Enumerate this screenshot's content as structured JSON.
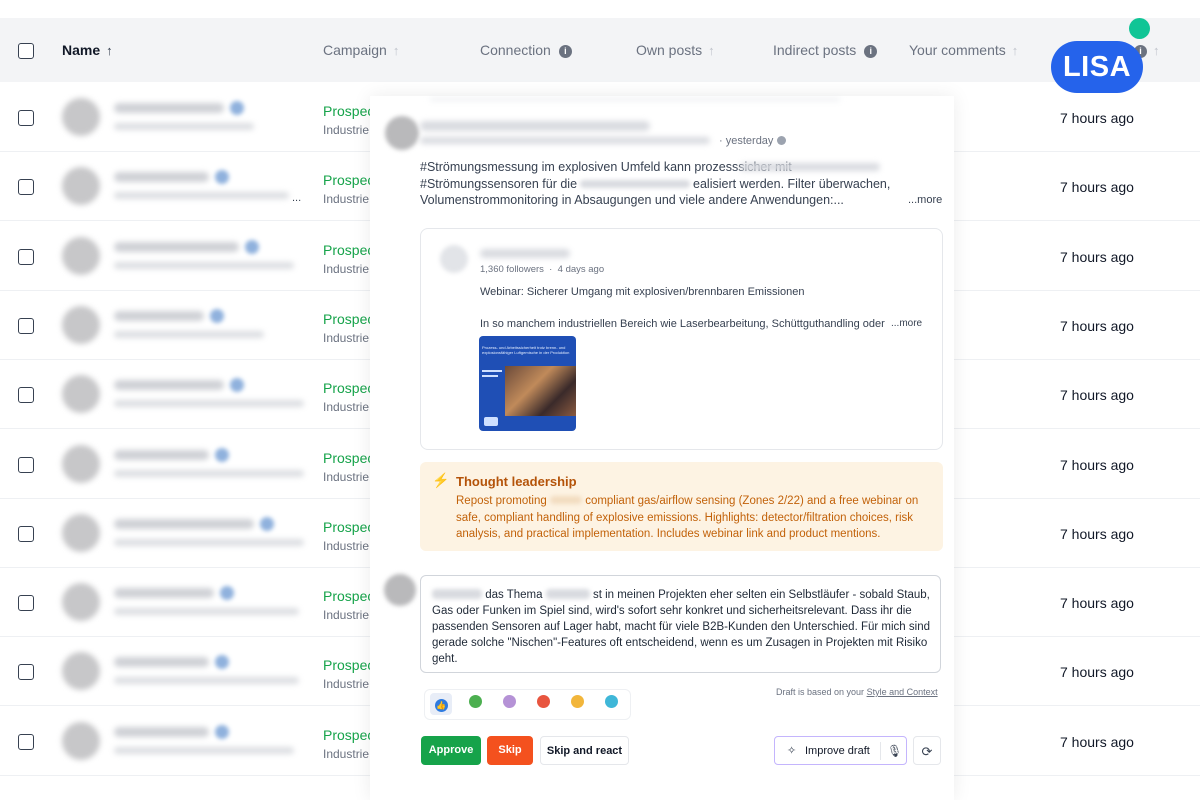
{
  "table": {
    "headers": {
      "name": "Name",
      "campaign": "Campaign",
      "connection": "Connection",
      "own_posts": "Own posts",
      "indirect_posts": "Indirect posts",
      "your_comments": "Your comments"
    },
    "rows": [
      {
        "campaign": "Prospec",
        "campaign_sub": "Industrie",
        "time": "7 hours ago"
      },
      {
        "campaign": "Prospec",
        "campaign_sub": "Industrie",
        "time": "7 hours ago"
      },
      {
        "campaign": "Prospec",
        "campaign_sub": "Industrie",
        "time": "7 hours ago"
      },
      {
        "campaign": "Prospec",
        "campaign_sub": "Industrie",
        "time": "7 hours ago"
      },
      {
        "campaign": "Prospec",
        "campaign_sub": "Industrie",
        "time": "7 hours ago"
      },
      {
        "campaign": "Prospec",
        "campaign_sub": "Industrie",
        "time": "7 hours ago"
      },
      {
        "campaign": "Prospec",
        "campaign_sub": "Industrie",
        "time": "7 hours ago"
      },
      {
        "campaign": "Prospec",
        "campaign_sub": "Industrie",
        "time": "7 hours ago"
      },
      {
        "campaign": "Prospec",
        "campaign_sub": "Industrie",
        "time": "7 hours ago"
      },
      {
        "campaign": "Prospec",
        "campaign_sub": "Industrie",
        "time": "7 hours ago"
      }
    ],
    "row_ellipsis": "..."
  },
  "brand": {
    "badge": "LISA",
    "color": "#2563eb",
    "dot_color": "#10c596"
  },
  "post": {
    "time": "yesterday",
    "line1": "#Strömungsmessung im explosiven Umfeld kann prozesssicher mit",
    "line2a": "#Strömungssensoren für die",
    "line2b": "ealisiert werden. Filter überwachen,",
    "line3": "Volumenstrommonitoring in Absaugungen und viele andere Anwendungen:...",
    "more": "...more"
  },
  "shared": {
    "followers": "1,360 followers",
    "time": "4 days ago",
    "title": "Webinar: Sicherer Umgang mit explosiven/brennbaren Emissionen",
    "body": "In so manchem industriellen Bereich wie Laserbearbeitung, Schüttguthandling oder",
    "more": "...more",
    "thumb_text": "Prozess- und Arbeitssicherheit trotz brenn- und explosionsfähiger Luftgemische in der Produktion"
  },
  "insight": {
    "title": "Thought leadership",
    "part1": "Repost promoting",
    "part2": "compliant gas/airflow sensing (Zones 2/22) and a free webinar on safe, compliant handling of explosive emissions. Highlights: detector/filtration choices, risk analysis, and practical implementation. Includes webinar link and product mentions."
  },
  "reply": {
    "p1": "das Thema",
    "p2": "st in meinen Projekten eher selten ein Selbstläufer - sobald Staub, Gas oder Funken im Spiel sind, wird's sofort sehr konkret und sicherheitsrelevant. Dass ihr die passenden Sensoren auf Lager habt, macht für viele B2B-Kunden den Unterschied. Für mich sind gerade solche \"Nischen\"-Features oft entscheidend, wenn es um Zusagen in Projekten mit Risiko geht."
  },
  "draft_note": {
    "text": "Draft is based on your",
    "link": "Style and Context"
  },
  "reactions": [
    "like",
    "celebrate",
    "support",
    "love",
    "insightful",
    "funny"
  ],
  "buttons": {
    "approve": "Approve",
    "skip": "Skip",
    "skip_react": "Skip and react",
    "improve": "Improve draft"
  },
  "colors": {
    "green": "#16a34a",
    "skip": "#f4511e",
    "insight_bg": "#fdf3e3",
    "insight_text": "#c2620a"
  }
}
